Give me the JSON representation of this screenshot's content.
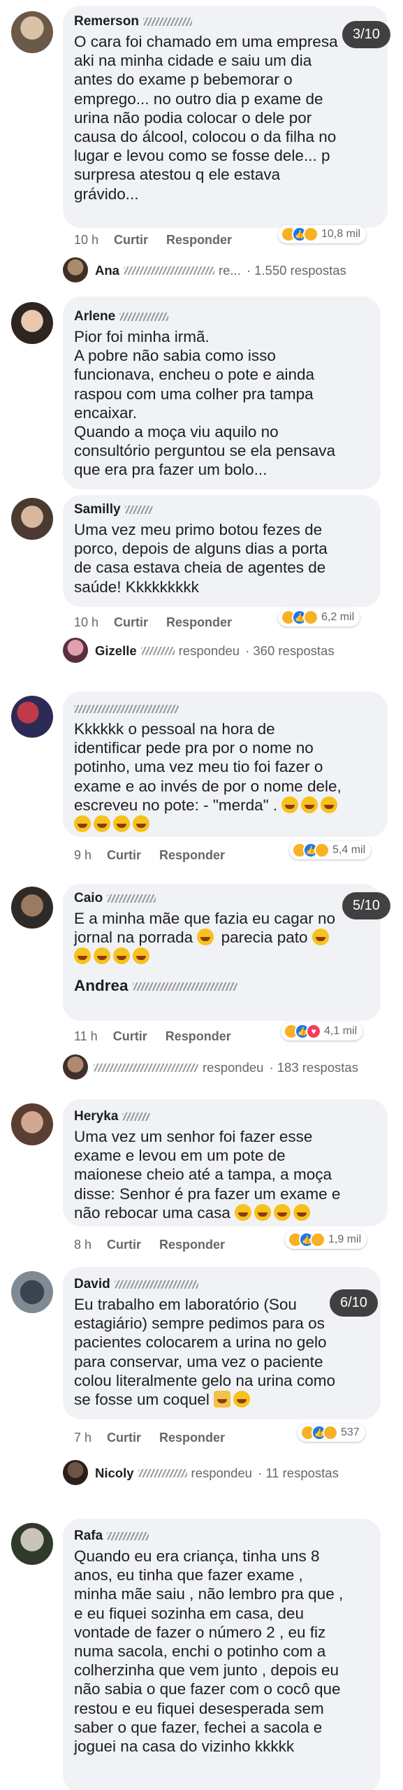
{
  "comments": [
    {
      "name": "Remerson",
      "lines": [
        "O cara foi chamado em uma empresa",
        "aki na minha cidade e saiu um dia",
        "antes do exame p bebemorar o",
        "emprego... no outro dia p exame de",
        "urina não podia colocar o dele por",
        "causa do álcool, colocou o da filha no",
        "lugar e levou como se fosse dele... p",
        "surpresa atestou q ele estava",
        "grávido..."
      ],
      "time": "10 h",
      "like_label": "Curtir",
      "reply_label": "Responder",
      "reactions_count": "10,8 mil",
      "badge": "3/10",
      "reply": {
        "name": "Ana",
        "action": "re...",
        "count": "· 1.550 respostas"
      }
    },
    {
      "name": "Arlene",
      "lines": [
        "Pior foi minha irmã.",
        "A pobre não sabia como isso",
        "funcionava, encheu o pote e ainda",
        "raspou com uma colher pra tampa",
        "encaixar.",
        "Quando a moça viu aquilo no",
        "consultório perguntou se ela pensava",
        "que era pra fazer um bolo..."
      ]
    },
    {
      "name": "Samilly",
      "lines": [
        "Uma vez meu primo botou fezes de",
        "porco, depois de alguns dias a porta",
        "de casa estava cheia de agentes de",
        "saúde! Kkkkkkkkk"
      ],
      "time": "10 h",
      "like_label": "Curtir",
      "reply_label": "Responder",
      "reactions_count": "6,2 mil",
      "reply": {
        "name": "Gizelle",
        "action": "respondeu",
        "count": "· 360 respostas"
      }
    },
    {
      "name": "",
      "lines": [
        "Kkkkkk o pessoal na hora de",
        "identificar pede pra por o nome no",
        "potinho, uma vez meu tio foi fazer o",
        "exame e ao invés de por o nome dele,",
        "escreveu no pote: - \"merda\" ."
      ],
      "time": "9 h",
      "like_label": "Curtir",
      "reply_label": "Responder",
      "reactions_count": "5,4 mil"
    },
    {
      "name": "Caio",
      "lines": [
        "E a minha mãe que fazia eu cagar no",
        "jornal na porrada",
        "",
        "Andrea"
      ],
      "time": "11 h",
      "like_label": "Curtir",
      "reply_label": "Responder",
      "reactions_count": "4,1 mil",
      "badge": "5/10",
      "reply": {
        "name": "",
        "action": "respondeu",
        "count": "· 183 respostas"
      }
    },
    {
      "name": "Heryka",
      "lines": [
        "Uma vez um senhor foi fazer esse",
        "exame e levou em um pote de",
        "maionese cheio até a tampa, a moça",
        "disse: Senhor é pra fazer um exame e",
        "não rebocar uma casa"
      ],
      "time": "8 h",
      "like_label": "Curtir",
      "reply_label": "Responder",
      "reactions_count": "1,9 mil"
    },
    {
      "name": "David",
      "lines": [
        "Eu trabalho em laboratório (Sou",
        "estagiário) sempre pedimos para os",
        "pacientes colocarem a urina no gelo",
        "para conservar, uma vez o paciente",
        "colou literalmente gelo na urina como",
        "se fosse um coquel"
      ],
      "time": "7 h",
      "like_label": "Curtir",
      "reply_label": "Responder",
      "reactions_count": "537",
      "badge": "6/10",
      "reply": {
        "name": "Nicoly",
        "action": "respondeu",
        "count": "· 11 respostas"
      }
    },
    {
      "name": "Rafa",
      "lines": [
        "Quando eu era criança, tinha uns 8",
        "anos, eu tinha que fazer exame ,",
        "minha mãe saiu , não lembro pra que ,",
        "e eu fiquei sozinha em casa, deu",
        "vontade de fazer o número 2 , eu fiz",
        "numa sacola, enchi o potinho com a",
        "colherzinha que vem junto , depois eu",
        "não sabia o que fazer com o cocô que",
        "restou e eu fiquei desesperada sem",
        "saber o que fazer, fechei a sacola e",
        "joguei na casa do vizinho kkkkk"
      ]
    }
  ],
  "colors": {
    "bubble": "#f0f2f5",
    "meta": "#65676b",
    "like": "#1877f2",
    "haha": "#f7b125",
    "love": "#f33e58"
  }
}
